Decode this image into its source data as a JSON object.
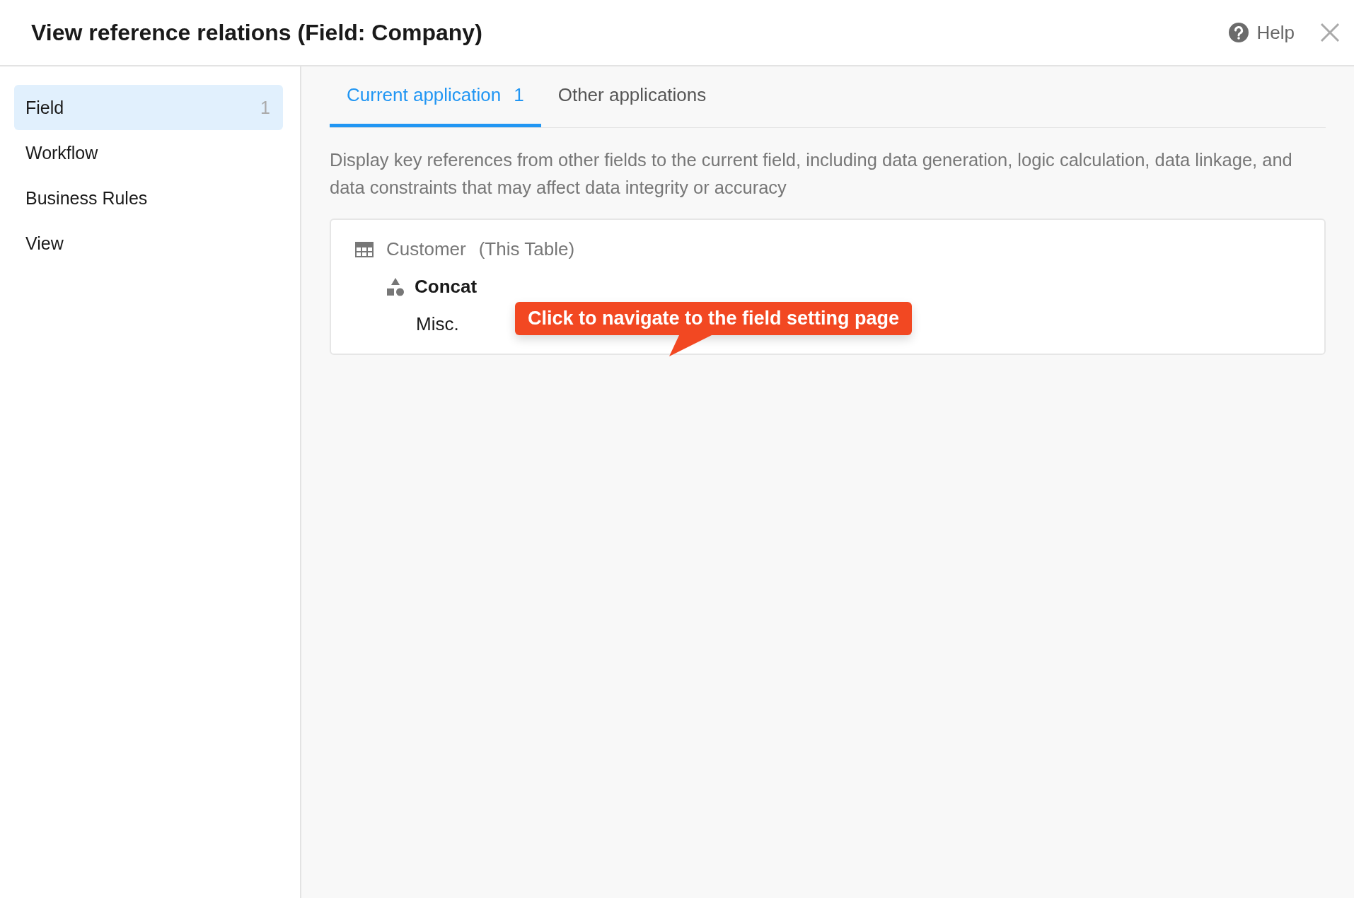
{
  "header": {
    "title": "View reference relations (Field: Company)",
    "help": "Help"
  },
  "sidebar": {
    "items": [
      {
        "label": "Field",
        "count": "1",
        "selected": true
      },
      {
        "label": "Workflow",
        "selected": false
      },
      {
        "label": "Business Rules",
        "selected": false
      },
      {
        "label": "View",
        "selected": false
      }
    ]
  },
  "tabs": [
    {
      "label": "Current application",
      "count": "1",
      "selected": true
    },
    {
      "label": "Other applications",
      "selected": false
    }
  ],
  "description": "Display key references from other fields to the current field, including data generation, logic calculation, data linkage, and data constraints that may affect data integrity or accuracy",
  "reference_card": {
    "table": "Customer",
    "table_note": "(This Table)",
    "field": "Concat",
    "field_group": "Misc."
  },
  "callout": {
    "text": "Click to navigate to the field setting page"
  }
}
